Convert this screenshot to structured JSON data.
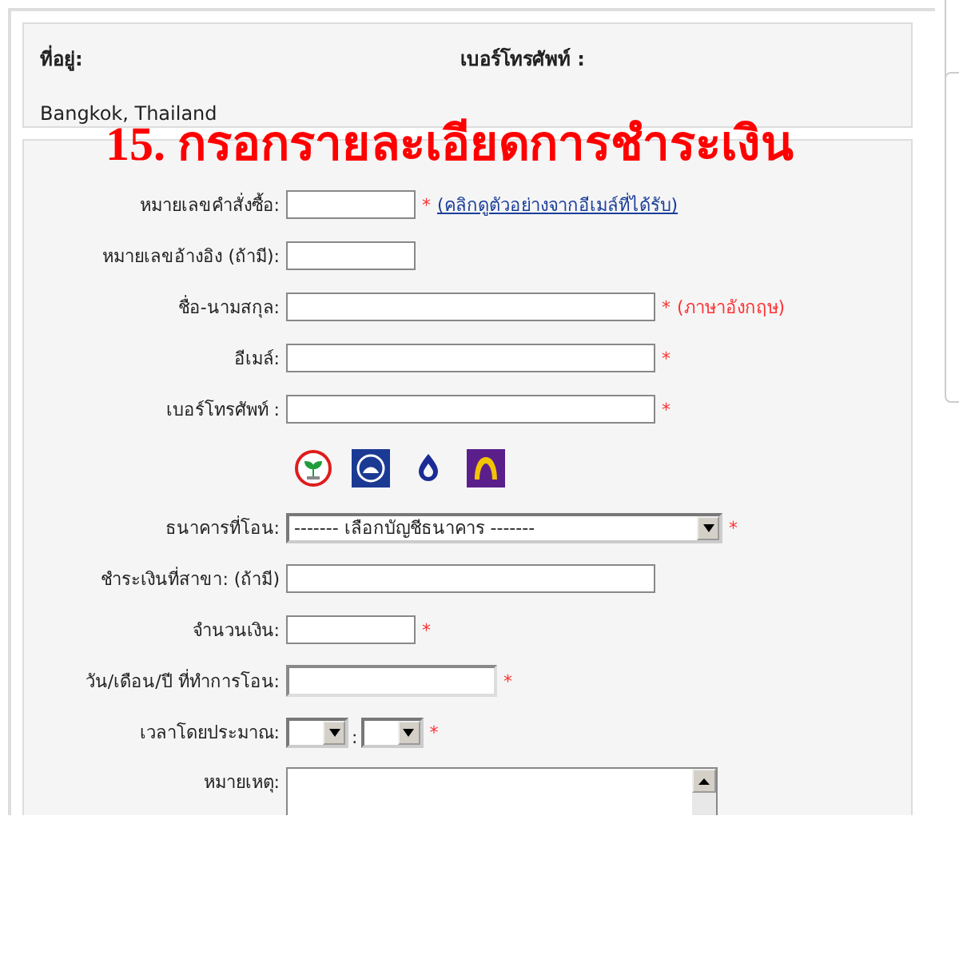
{
  "contact": {
    "address_label": "ที่อยู่:",
    "address_value": "Bangkok, Thailand",
    "phone_label": "เบอร์โทรศัพท์ :"
  },
  "heading": "15. กรอกรายละเอียดการชำระเงิน",
  "fields": [
    {
      "kind": "short",
      "label": "หมายเลขคำสั่งซื้อ:",
      "marker": "*",
      "note": {
        "kind": "link",
        "text": "(คลิกดูตัวอย่างจากอีเมล์ที่ได้รับ)"
      }
    },
    {
      "kind": "short",
      "label": "หมายเลขอ้างอิง (ถ้ามี):"
    },
    {
      "kind": "long",
      "label": "ชื่อ-นามสกุล:",
      "marker": "*",
      "note": {
        "kind": "plain",
        "text": "(ภาษาอังกฤษ)"
      }
    },
    {
      "kind": "long",
      "label": "อีเมล์:",
      "marker": "*"
    },
    {
      "kind": "long",
      "label": "เบอร์โทรศัพท์ :",
      "marker": "*"
    },
    {
      "kind": "bank-logos"
    },
    {
      "kind": "select",
      "label": "ธนาคารที่โอน:",
      "value": "------- เลือกบัญชีธนาคาร -------",
      "marker": "*"
    },
    {
      "kind": "long",
      "label": "ชำระเงินที่สาขา: (ถ้ามี)"
    },
    {
      "kind": "short",
      "label": "จำนวนเงิน:",
      "marker": "*"
    },
    {
      "kind": "medium",
      "label": "วัน/เดือน/ปี ที่ทำการโอน:",
      "marker": "*"
    },
    {
      "kind": "time",
      "label": "เวลาโดยประมาณ:",
      "separator": ":",
      "marker": "*"
    },
    {
      "kind": "textarea",
      "label": "หมายเหตุ:"
    }
  ]
}
